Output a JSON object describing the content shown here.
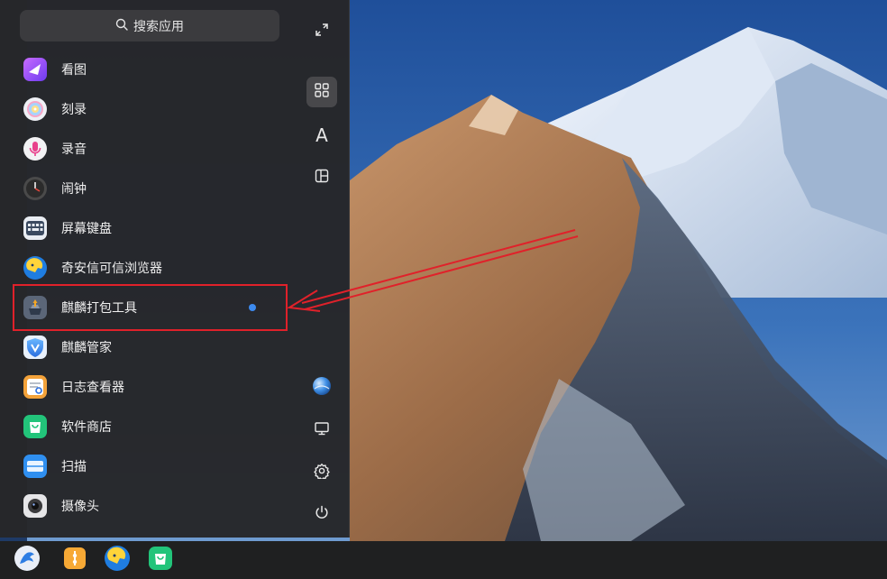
{
  "search": {
    "placeholder": "搜索应用"
  },
  "apps": [
    {
      "label": "看图",
      "icon": "image-viewer-icon"
    },
    {
      "label": "刻录",
      "icon": "disc-burner-icon"
    },
    {
      "label": "录音",
      "icon": "microphone-icon"
    },
    {
      "label": "闹钟",
      "icon": "alarm-clock-icon"
    },
    {
      "label": "屏幕键盘",
      "icon": "keyboard-icon"
    },
    {
      "label": "奇安信可信浏览器",
      "icon": "browser-icon"
    },
    {
      "label": "麒麟打包工具",
      "icon": "package-tool-icon",
      "new": true
    },
    {
      "label": "麒麟管家",
      "icon": "shield-icon"
    },
    {
      "label": "日志查看器",
      "icon": "log-viewer-icon"
    },
    {
      "label": "软件商店",
      "icon": "store-icon"
    },
    {
      "label": "扫描",
      "icon": "scanner-icon"
    },
    {
      "label": "摄像头",
      "icon": "camera-icon"
    }
  ],
  "sidebar": {
    "buttons": [
      {
        "name": "fullscreen-icon",
        "active": false
      },
      {
        "name": "grid-view-icon",
        "active": true
      },
      {
        "name": "alphabet-sort-icon",
        "active": false,
        "text": "A"
      },
      {
        "name": "category-view-icon",
        "active": false
      },
      {
        "name": "user-avatar-icon",
        "active": false
      },
      {
        "name": "computer-icon",
        "active": false
      },
      {
        "name": "settings-icon",
        "active": false
      },
      {
        "name": "power-icon",
        "active": false
      }
    ]
  },
  "taskbar": {
    "items": [
      "start-menu-icon",
      "file-manager-icon",
      "browser-icon",
      "store-icon"
    ]
  },
  "colors": {
    "menu_bg": "#262628",
    "highlight": "#e0212a",
    "new_dot": "#3d8bf0"
  }
}
